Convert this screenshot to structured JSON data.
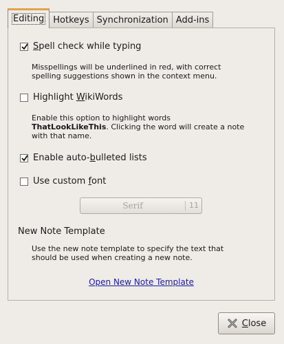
{
  "tabs": [
    {
      "label": "Editing",
      "active": true
    },
    {
      "label": "Hotkeys",
      "active": false
    },
    {
      "label": "Synchronization",
      "active": false
    },
    {
      "label": "Add-ins",
      "active": false
    }
  ],
  "editing": {
    "spell_check": {
      "pre": "",
      "mnemonic": "S",
      "post": "pell check while typing",
      "checked": true,
      "description_line1": "Misspellings will be underlined in red, with correct",
      "description_line2": "spelling suggestions shown in the context menu."
    },
    "wikiwords": {
      "pre": "Highlight ",
      "mnemonic": "W",
      "post": "ikiWords",
      "checked": false,
      "description_line1": "Enable this option to highlight words",
      "description_bold": "ThatLookLikeThis",
      "description_line2_rest": ". Clicking the word will create a note",
      "description_line3": "with that name."
    },
    "auto_bullets": {
      "pre": "Enable auto-",
      "mnemonic": "b",
      "post": "ulleted lists",
      "checked": true
    },
    "custom_font": {
      "pre": "Use custom ",
      "mnemonic": "f",
      "post": "ont",
      "checked": false
    },
    "font_button": {
      "font_name": "Serif",
      "font_size": "11"
    },
    "template": {
      "heading": "New Note Template",
      "description_line1": "Use the new note template to specify the text that",
      "description_line2": "should be used when creating a new note.",
      "link": "Open New Note Template"
    }
  },
  "close_button": {
    "mnemonic": "C",
    "rest": "lose",
    "icon": "close-x-icon"
  }
}
